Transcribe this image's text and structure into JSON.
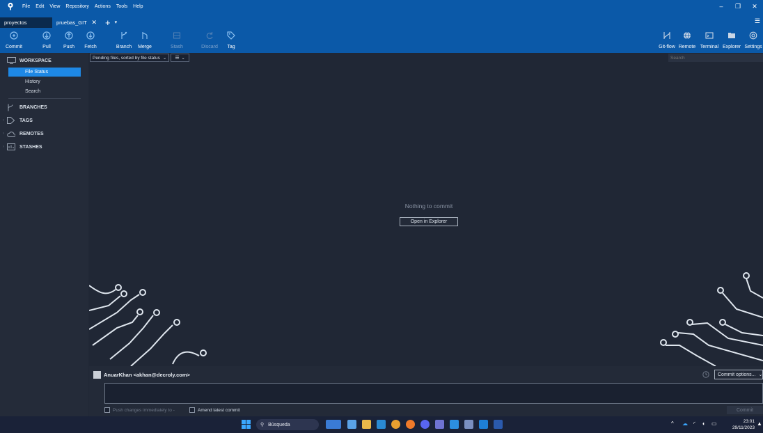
{
  "menu": [
    "File",
    "Edit",
    "View",
    "Repository",
    "Actions",
    "Tools",
    "Help"
  ],
  "tabs": [
    {
      "label": "proyectos"
    },
    {
      "label": "pruebas_GIT"
    }
  ],
  "toolbar": {
    "left": [
      {
        "label": "Commit",
        "icon": "commit-icon"
      },
      {
        "label": "Pull",
        "icon": "pull-icon"
      },
      {
        "label": "Push",
        "icon": "push-icon"
      },
      {
        "label": "Fetch",
        "icon": "fetch-icon"
      },
      {
        "label": "Branch",
        "icon": "branch-icon"
      },
      {
        "label": "Merge",
        "icon": "merge-icon"
      },
      {
        "label": "Stash",
        "icon": "stash-icon"
      },
      {
        "label": "Discard",
        "icon": "discard-icon"
      },
      {
        "label": "Tag",
        "icon": "tag-icon"
      }
    ],
    "right": [
      {
        "label": "Git-flow",
        "icon": "git-flow-icon"
      },
      {
        "label": "Remote",
        "icon": "remote-icon"
      },
      {
        "label": "Terminal",
        "icon": "terminal-icon"
      },
      {
        "label": "Explorer",
        "icon": "explorer-icon"
      },
      {
        "label": "Settings",
        "icon": "settings-icon"
      }
    ]
  },
  "sidebar": {
    "workspace": "WORKSPACE",
    "workspace_items": [
      "File Status",
      "History",
      "Search"
    ],
    "branches": "BRANCHES",
    "tags": "TAGS",
    "remotes": "REMOTES",
    "stashes": "STASHES"
  },
  "filter": {
    "pending": "Pending files, sorted by file status",
    "search_placeholder": "Search"
  },
  "content": {
    "empty_message": "Nothing to commit",
    "open_explorer": "Open in Explorer"
  },
  "commit": {
    "author": "AnuarKhan <akhan@decroly.com>",
    "options": "Commit options...",
    "push_immediately": "Push changes immediately to -",
    "amend": "Amend latest commit",
    "button": "Commit"
  },
  "taskbar": {
    "search": "Búsqueda",
    "time": "23:01",
    "date": "29/11/2023"
  },
  "colors": {
    "title_bar": "#0b59a8",
    "background": "#202735",
    "sidebar": "#242b39",
    "selected": "#1e88e5"
  }
}
